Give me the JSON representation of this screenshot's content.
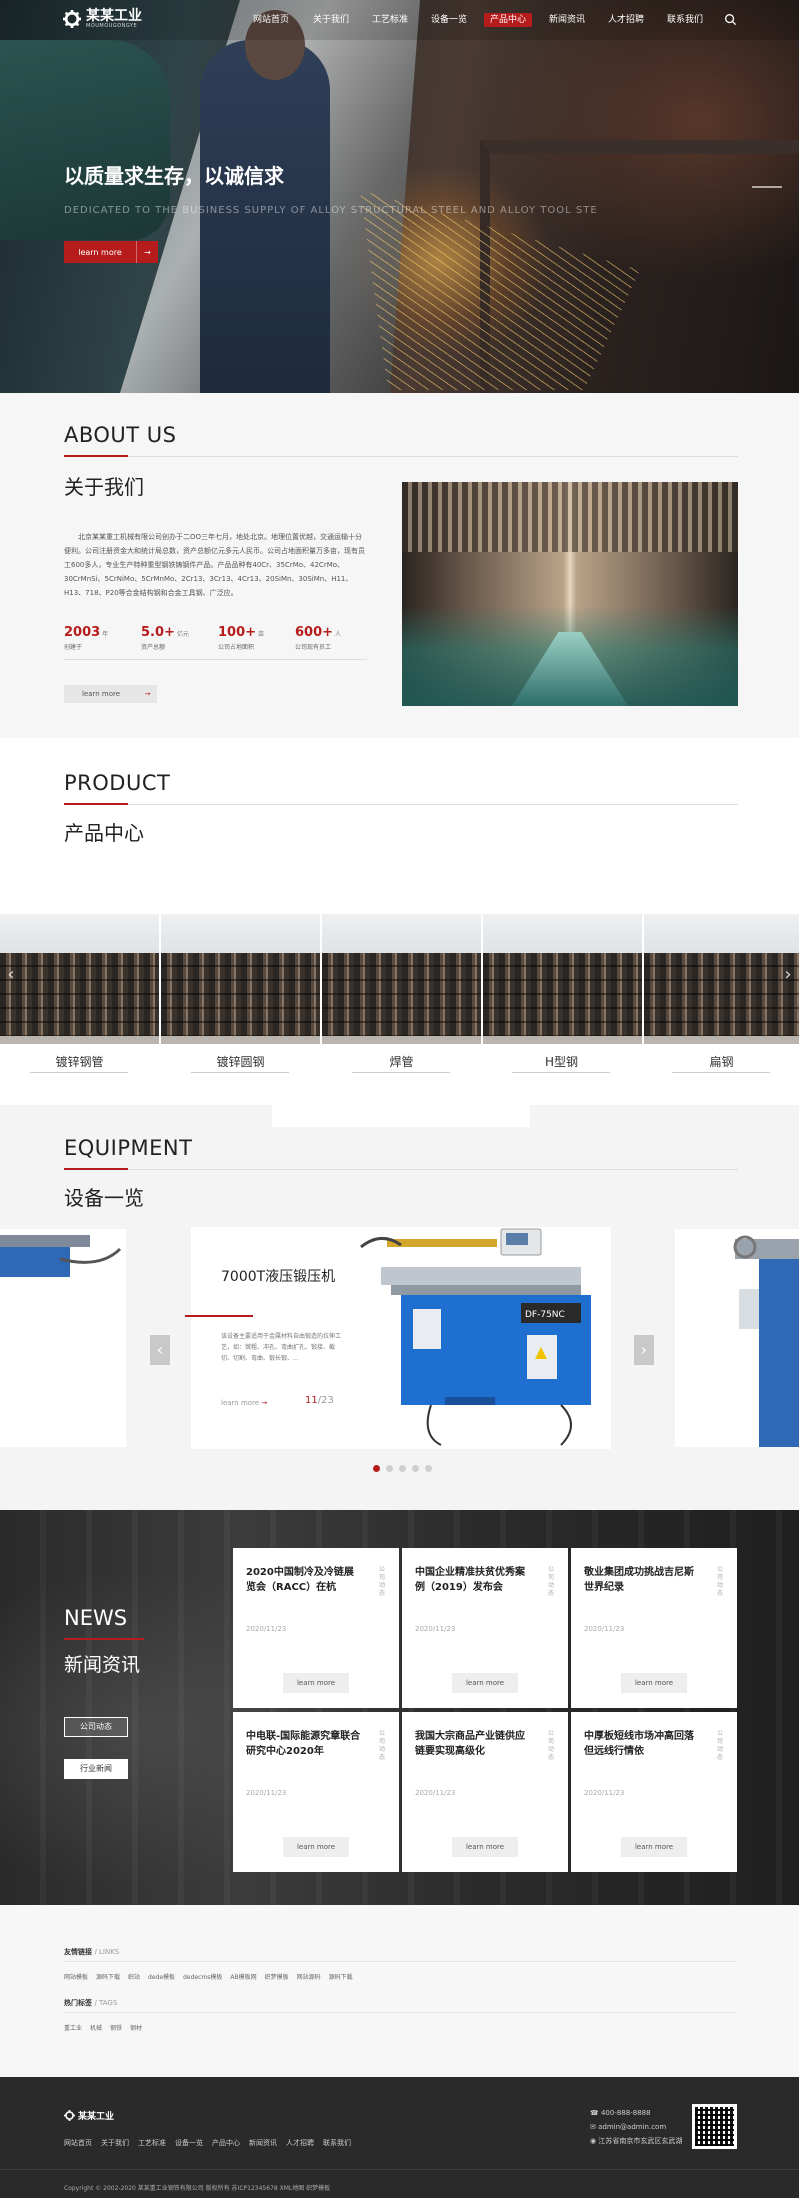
{
  "brand": {
    "name": "某某工业",
    "sub": "MOUMOUGONGYE"
  },
  "nav": [
    {
      "label": "网站首页",
      "active": false
    },
    {
      "label": "关于我们",
      "active": false
    },
    {
      "label": "工艺标准",
      "active": false
    },
    {
      "label": "设备一览",
      "active": false
    },
    {
      "label": "产品中心",
      "active": true
    },
    {
      "label": "新闻资讯",
      "active": false
    },
    {
      "label": "人才招聘",
      "active": false
    },
    {
      "label": "联系我们",
      "active": false
    }
  ],
  "hero": {
    "title": "以质量求生存，以诚信求",
    "subtitle": "DEDICATED TO THE BUSINESS SUPPLY OF ALLOY STRUCTURAL STEEL AND ALLOY TOOL STE",
    "button": "learn more",
    "arrow": "→"
  },
  "about": {
    "en": "ABOUT US",
    "cn": "关于我们",
    "text": "北京某某重工机械有限公司创办于二OO三年七月，地处北京。地理位置优越，交通运输十分便利。公司注册资金大和统计局总数，资产总额亿元多元人民币。公司占地面积量万多亩，现有员工600多人，专业生产特种重型钢铁铸钢件产品。产品品种有40Cr、35CrMo、42CrMo、30CrMnSi、5CrNiMo、5CrMnMo、2Cr13、3Cr13、4Cr13、20SiMn、30SiMn、H11、H13、718、P20等合金结构钢和合金工具钢、广泛应。",
    "stats": [
      {
        "num": "2003",
        "unit": "年",
        "label": "创建于"
      },
      {
        "num": "5.0+",
        "unit": "亿元",
        "label": "资产总额"
      },
      {
        "num": "100+",
        "unit": "亩",
        "label": "公司占地面积"
      },
      {
        "num": "600+",
        "unit": "人",
        "label": "公司现有员工"
      }
    ],
    "button": "learn more",
    "arrow": "→"
  },
  "product": {
    "en": "PRODUCT",
    "cn": "产品中心",
    "items": [
      "镀锌钢管",
      "镀锌圆钢",
      "焊管",
      "H型钢",
      "扁钢"
    ],
    "prev": "‹",
    "next": "›"
  },
  "equipment": {
    "en": "EQUIPMENT",
    "cn": "设备一览",
    "card": {
      "title": "7000T液压锻压机",
      "desc": "该设备主要适用于金属材料自由锻造的拉伸工艺，如：镦粗、冲孔、弯曲扩孔、锻接、截切、切割、弯曲、锻长锻、...",
      "more": "learn more",
      "arrow": "→",
      "current": "11",
      "total": "/23"
    },
    "prev": "‹",
    "next": "›",
    "dots": 5,
    "active_dot": 0
  },
  "news": {
    "en": "NEWS",
    "cn": "新闻资讯",
    "buttons": [
      "公司动态",
      "行业新闻"
    ],
    "cards": [
      {
        "title": "2020中国制冷及冷链展览会（RACC）在杭",
        "vtag": "公司动态",
        "date": "2020/11/23",
        "more": "learn more"
      },
      {
        "title": "中国企业精准扶贫优秀案例（2019）发布会",
        "vtag": "公司动态",
        "date": "2020/11/23",
        "more": "learn more"
      },
      {
        "title": "敬业集团成功挑战吉尼斯世界纪录",
        "vtag": "公司动态",
        "date": "2020/11/23",
        "more": "learn more"
      },
      {
        "title": "中电联-国际能源究章联合研究中心2020年",
        "vtag": "公司动态",
        "date": "2020/11/23",
        "more": "learn more"
      },
      {
        "title": "我国大宗商品产业链供应链要实现高级化",
        "vtag": "公司动态",
        "date": "2020/11/23",
        "more": "learn more"
      },
      {
        "title": "中厚板短线市场冲高回落 但远线行情依",
        "vtag": "公司动态",
        "date": "2020/11/23",
        "more": "learn more"
      }
    ]
  },
  "links": {
    "friend_title": "友情链接",
    "friend_sub": "/ LINKS",
    "friend": [
      "网站模板",
      "源码下载",
      "织站",
      "dede模板",
      "dedecms模板",
      "AB模板网",
      "织梦模板",
      "网站源码",
      "源码下载"
    ],
    "tags_title": "热门标签",
    "tags_sub": "/ TAGS",
    "tags": [
      "重工业",
      "机械",
      "钢铁",
      "钢材"
    ]
  },
  "footer": {
    "logo": "某某工业",
    "nav": [
      "网站首页",
      "关于我们",
      "工艺标准",
      "设备一览",
      "产品中心",
      "新闻资讯",
      "人才招聘",
      "联系我们"
    ],
    "phone": "400-888-8888",
    "email": "admin@admin.com",
    "address": "江苏省南京市玄武区玄武湖",
    "copyright": "Copyright © 2002-2020 某某重工业钢铁有限公司 版权所有 苏ICP12345678 XML地图 织梦模板"
  }
}
